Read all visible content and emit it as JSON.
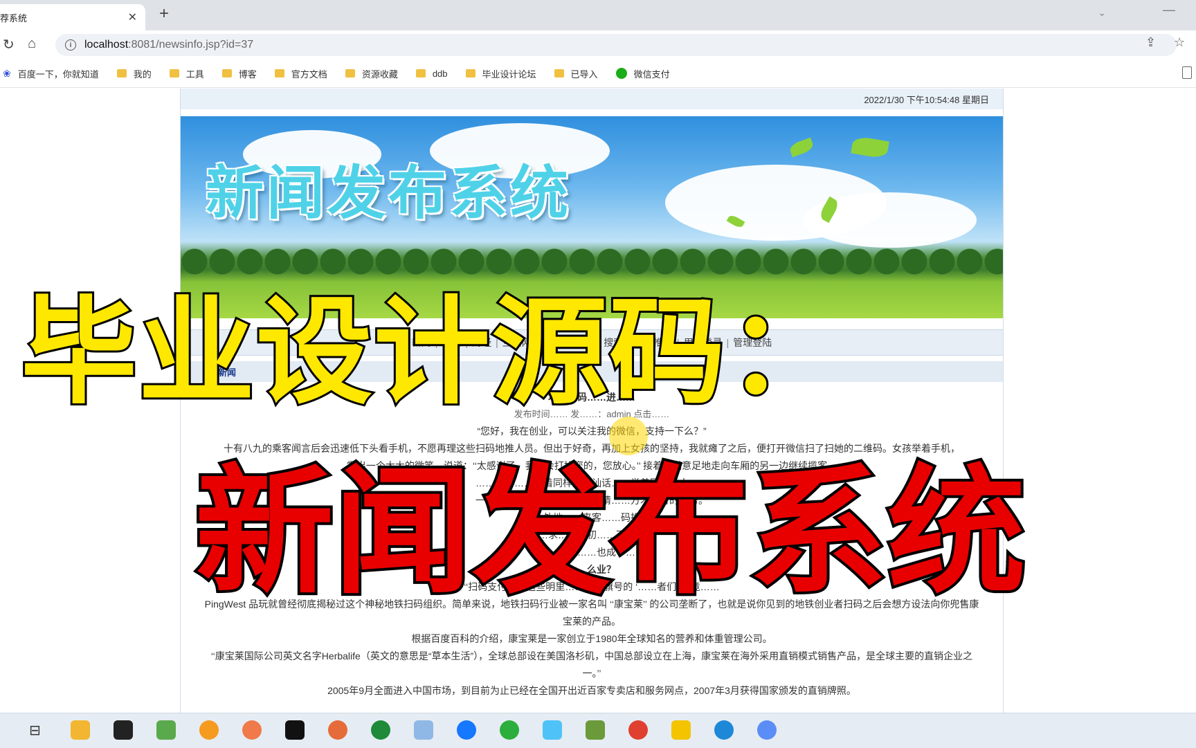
{
  "browser": {
    "tab_title": "荐系统",
    "tab_close": "✕",
    "new_tab": "+",
    "url_host": "localhost",
    "url_path": ":8081/newsinfo.jsp?id=37",
    "bookmarks": [
      {
        "label": "百度一下，你就知道",
        "icon": "paw-icon"
      },
      {
        "label": "我的",
        "icon": "folder-icon"
      },
      {
        "label": "工具",
        "icon": "folder-icon"
      },
      {
        "label": "博客",
        "icon": "folder-icon"
      },
      {
        "label": "官方文档",
        "icon": "folder-icon"
      },
      {
        "label": "资源收藏",
        "icon": "folder-icon"
      },
      {
        "label": "ddb",
        "icon": "folder-icon"
      },
      {
        "label": "毕业设计论坛",
        "icon": "folder-icon"
      },
      {
        "label": "已导入",
        "icon": "folder-icon"
      },
      {
        "label": "微信支付",
        "icon": "wechat-icon"
      }
    ]
  },
  "page": {
    "datetime": "2022/1/30 下午10:54:48  星期日",
    "banner_title": "新闻发布系统",
    "nav_items": [
      "新闻",
      "社会",
      "财经",
      "互联网",
      "…",
      "…",
      "…",
      "搜索",
      "个性推荐",
      "用户登录",
      "管理登陆"
    ],
    "section_label": "新闻",
    "article": {
      "title": "地铁扫码……进……",
      "meta": "发布时间……  发……：admin  点击……",
      "paragraphs": [
        "“您好，我在创业，可以关注我的微信，支持一下么？”",
        "十有八九的乘客闻言后会迅速低下头看手机，不愿再理这些扫码地推人员。但出于好奇，再加上女孩的坚持，我就瘫了之后，便打开微信扫了扫她的二维码。女孩举着手机，",
        "露出一个大大的微笑，说道：‘‘太感谢了，我不会打扰您的，您放心。’’ 接着心满意足地走向车厢的另一边继续揽客。",
        "……一个……看着同样的搭讪话……举着同样磁大……",
        "一年里，……撕开……推……请……方才文讨的攻势。",
        "……外地……来客……码投……",
        "……求……讨初……不用……",
        "……到的……也成了……",
        "……么业？",
        "‘‘扫码支付……这些明里……创业旗号的 ‘……者们’ 究竟……",
        "PingWest 品玩就曾经彻底揭秘过这个神秘地铁扫码组织。简单来说，地铁扫码行业被一家名叫 ‘‘康宝莱’’ 的公司垄断了，也就是说你见到的地铁创业者扫码之后会想方设法向你兜售康宝莱的产品。",
        "根据百度百科的介绍，康宝莱是一家创立于1980年全球知名的营养和体重管理公司。",
        "‘‘康宝莱国际公司英文名字Herbalife（英文的意思是“草本生活”），全球总部设在美国洛杉矶，中国总部设立在上海，康宝莱在海外采用直销模式销售产品，是全球主要的直销企业之一。’’",
        "2005年9月全面进入中国市场，到目前为止已经在全国开出近百家专卖店和服务网点，2007年3月获得国家颁发的直销牌照。"
      ]
    }
  },
  "overlay": {
    "line1": "毕业设计源码：",
    "line2": "新闻发布系统"
  },
  "taskbar": {
    "task_view_label": "⊟"
  },
  "colors": {
    "overlay_yellow": "#ffe800",
    "overlay_red": "#e80000",
    "banner_title": "#4fd2e8"
  }
}
